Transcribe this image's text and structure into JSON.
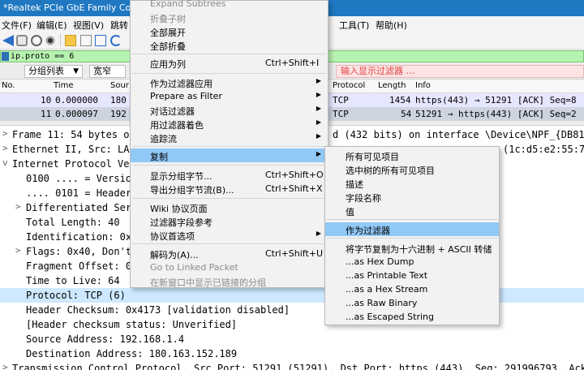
{
  "window": {
    "title": "*Realtek PCIe GbE Family Co"
  },
  "menubar": {
    "file": "文件(F)",
    "edit": "编辑(E)",
    "view": "视图(V)",
    "go": "跳转",
    "tools": "工具(T)",
    "help": "帮助(H)"
  },
  "toolbar": {
    "icons": [
      "shark-fin-start-icon",
      "stop-icon",
      "restart-icon",
      "options-gear-icon",
      "open-file-icon",
      "save-file-icon",
      "close-file-icon",
      "reload-icon"
    ]
  },
  "filter": {
    "value": "ip.proto == 6"
  },
  "search": {
    "mode": "分组列表",
    "charset": "宽窄",
    "display_filter_placeholder": "输入显示过滤器 …"
  },
  "packet_list": {
    "columns": {
      "no": "No.",
      "time": "Time",
      "source": "Sour",
      "protocol": "Protocol",
      "length": "Length",
      "info": "Info"
    },
    "rows": [
      {
        "no": "10",
        "time": "0.000000",
        "source": "180",
        "protocol": "TCP",
        "length": "1454",
        "info": "https(443) → 51291 [ACK] Seq=8"
      },
      {
        "no": "11",
        "time": "0.000097",
        "source": "192",
        "protocol": "TCP",
        "length": "54",
        "info": "51291 → https(443) [ACK] Seq=2"
      }
    ]
  },
  "details": {
    "frame": "Frame 11: 54 bytes on",
    "frame_tail": "d (432 bits) on interface \\Device\\NPF_{DB814D",
    "ethernet": "Ethernet II, Src: LAP",
    "ethernet_tail": "(1c:d5:e2:55:79:c",
    "ip": "Internet Protocol Ver",
    "version": "0100 .... = Versio",
    "header_len": ".... 0101 = Header",
    "dsf": "Differentiated Ser",
    "total_length": "Total Length: 40",
    "identification": "Identification: 0x",
    "flags": "Flags: 0x40, Don't",
    "frag_offset": "Fragment Offset: 0",
    "ttl": "Time to Live: 64",
    "protocol": "Protocol: TCP (6)",
    "checksum": "Header Checksum: 0x4173 [validation disabled]",
    "checksum_status": "[Header checksum status: Unverified]",
    "src": "Source Address: 192.168.1.4",
    "dst": "Destination Address: 180.163.152.189",
    "tcp": "Transmission Control Protocol, Src Port: 51291 (51291), Dst Port: https (443), Seq: 291996793, Ack: 8"
  },
  "context_menu": {
    "expand_subtrees": "Expand Subtrees",
    "collapse_subtree": "折叠子树",
    "expand_all": "全部展开",
    "collapse_all": "全部折叠",
    "apply_as_column": "应用为列",
    "apply_as_column_shortcut": "Ctrl+Shift+I",
    "apply_as_filter": "作为过滤器应用",
    "prepare_as_filter": "Prepare as Filter",
    "conversation_filter": "对话过滤器",
    "colorize_with_filter": "用过滤器着色",
    "follow_stream": "追踪流",
    "copy": "复制",
    "show_packet_bytes": "显示分组字节...",
    "show_packet_bytes_shortcut": "Ctrl+Shift+O",
    "export_packet_bytes": "导出分组字节流(B)...",
    "export_packet_bytes_shortcut": "Ctrl+Shift+X",
    "wiki_protocol_page": "Wiki 协议页面",
    "filter_field_reference": "过滤器字段参考",
    "protocol_preferences": "协议首选项",
    "decode_as": "解码为(A)...",
    "decode_as_shortcut": "Ctrl+Shift+U",
    "go_to_linked_packet": "Go to Linked Packet",
    "show_linked_packet_new_window": "在新窗口中显示已链接的分组"
  },
  "copy_submenu": {
    "all_visible_items": "所有可见项目",
    "all_visible_selected_tree_items": "选中树的所有可见项目",
    "description": "描述",
    "field_name": "字段名称",
    "value": "值",
    "as_filter": "作为过滤器",
    "bytes_hex_ascii": "将字节复制为十六进制 + ASCII 转储",
    "as_hex_dump": "...as Hex Dump",
    "as_printable_text": "...as Printable Text",
    "as_hex_stream": "...as a Hex Stream",
    "as_raw_binary": "...as Raw Binary",
    "as_escaped_string": "...as Escaped String"
  },
  "colors": {
    "titlebar": "#1f78c1",
    "filter_ok": "#b7f3b0",
    "menu_highlight": "#90c8f6",
    "row_selected": "#cde8ff",
    "display_filter_bg": "#fde3e3"
  }
}
